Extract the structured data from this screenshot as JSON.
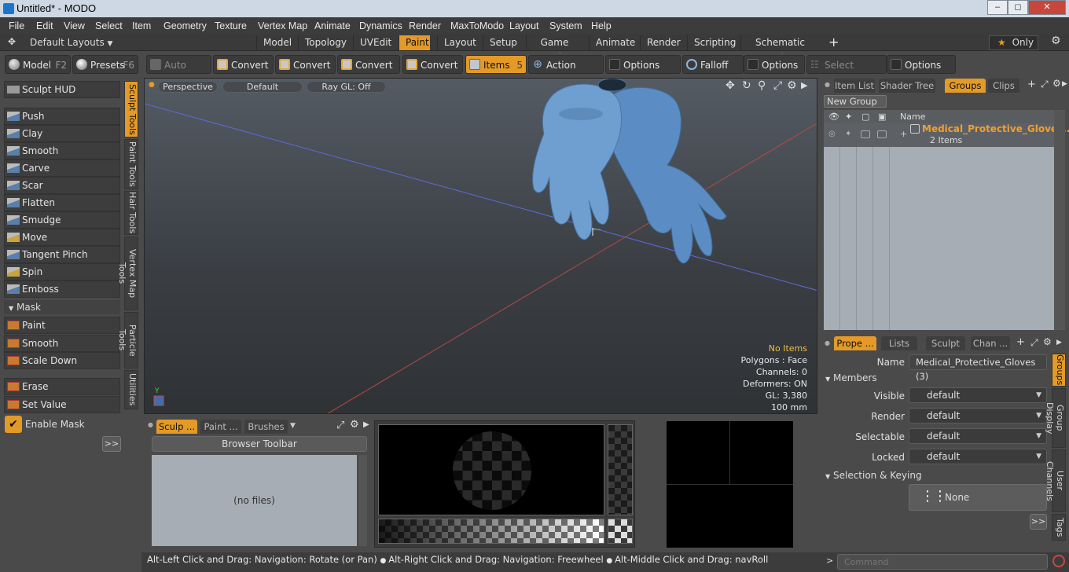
{
  "window": {
    "title": "Untitled* - MODO"
  },
  "menubar": [
    "File",
    "Edit",
    "View",
    "Select",
    "Item",
    "Geometry",
    "Texture",
    "Vertex Map",
    "Animate",
    "Dynamics",
    "Render",
    "MaxToModo",
    "Layout",
    "System",
    "Help"
  ],
  "layoutbar": {
    "layouts_label": "Default Layouts",
    "tabs": [
      "Model",
      "Topology",
      "UVEdit",
      "Paint",
      "Layout",
      "Setup",
      "Game Tools",
      "Animate",
      "Render",
      "Scripting",
      "Schematic Fusion"
    ],
    "active_tab": "Paint",
    "add": "+",
    "only_label": "Only"
  },
  "toolbar": {
    "model": {
      "label": "Model",
      "key": "F2"
    },
    "presets": {
      "label": "Presets",
      "key": "F6"
    },
    "auto_select": "Auto Select",
    "convert1": "Convert",
    "convert2": "Convert",
    "convert3": "Convert",
    "convert4": "Convert",
    "items": {
      "label": "Items",
      "key": "5"
    },
    "action_center": "Action Center",
    "options1": "Options",
    "falloff": "Falloff",
    "options2": "Options",
    "select_through": "Select Through",
    "options3": "Options"
  },
  "sculpt": {
    "hud": "Sculpt HUD",
    "tools": [
      "Push",
      "Clay",
      "Smooth",
      "Carve",
      "Scar",
      "Flatten",
      "Smudge",
      "Move",
      "Tangent Pinch",
      "Spin",
      "Emboss"
    ],
    "mask_header": "Mask",
    "mask_tools": [
      "Paint",
      "Smooth",
      "Scale Down"
    ],
    "erase": "Erase",
    "set_value": "Set Value",
    "enable_mask": "Enable Mask",
    "more": ">>"
  },
  "vtabs": [
    "Sculpt Tools",
    "Paint Tools",
    "Hair Tools",
    "Vertex Map Tools",
    "Particle Tools",
    "Utilities"
  ],
  "viewport": {
    "view": "Perspective",
    "style": "Default",
    "raygl": "Ray GL: Off",
    "info": {
      "items": "No Items",
      "polygons": "Polygons : Face",
      "channels": "Channels: 0",
      "deformers": "Deformers: ON",
      "gl": "GL: 3,380",
      "scale": "100 mm"
    },
    "axis_y": "Y"
  },
  "brushes_panel": {
    "tabs": [
      "Sculp ...",
      "Paint ...",
      "Brushes"
    ],
    "toolbar": "Browser Toolbar",
    "empty": "(no files)"
  },
  "groups_panel": {
    "tabs": [
      "Item List",
      "Shader Tree",
      "Groups",
      "Clips"
    ],
    "active_tab": "Groups",
    "new_group": "New Group",
    "column_name": "Name",
    "group_name": "Medical_Protective_Gloves...",
    "group_count": "2 Items"
  },
  "props_panel": {
    "tabs": [
      "Prope ...",
      "Lists",
      "Sculpt",
      "Chan ..."
    ],
    "name_label": "Name",
    "name_value": "Medical_Protective_Gloves (3)",
    "members_header": "Members",
    "visible_label": "Visible",
    "visible_value": "default",
    "render_label": "Render",
    "render_value": "default",
    "selectable_label": "Selectable",
    "selectable_value": "default",
    "locked_label": "Locked",
    "locked_value": "default",
    "selection_header": "Selection & Keying",
    "none_label": "None",
    "more": ">>",
    "side_tabs": [
      "Groups",
      "Group Display",
      "User Channels",
      "Tags"
    ]
  },
  "status": {
    "text1": "Alt-Left Click and Drag: Navigation: Rotate (or Pan)",
    "text2": "Alt-Right Click and Drag: Navigation: Freewheel",
    "text3": "Alt-Middle Click and Drag: navRoll"
  },
  "command": {
    "placeholder": "Command"
  },
  "colors": {
    "accent": "#e39a28",
    "glove": "#6f9fd0",
    "group_name": "#f0a030"
  }
}
